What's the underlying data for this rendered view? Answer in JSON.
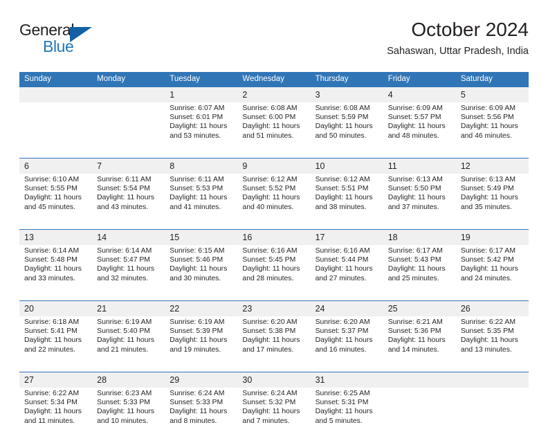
{
  "brand": {
    "line1": "General",
    "line2": "Blue",
    "logo_icon": "blue-triangle-icon",
    "accent_color": "#2177b8",
    "triangle_color": "#1361a4"
  },
  "header": {
    "month_title": "October 2024",
    "location": "Sahaswan, Uttar Pradesh, India"
  },
  "calendar": {
    "header_bg": "#3075b6",
    "daynum_bg": "#f0f0f0",
    "weekday_headers": [
      "Sunday",
      "Monday",
      "Tuesday",
      "Wednesday",
      "Thursday",
      "Friday",
      "Saturday"
    ],
    "weeks": [
      [
        {
          "day": "",
          "info": ""
        },
        {
          "day": "",
          "info": ""
        },
        {
          "day": "1",
          "info": "Sunrise: 6:07 AM\nSunset: 6:01 PM\nDaylight: 11 hours\nand 53 minutes."
        },
        {
          "day": "2",
          "info": "Sunrise: 6:08 AM\nSunset: 6:00 PM\nDaylight: 11 hours\nand 51 minutes."
        },
        {
          "day": "3",
          "info": "Sunrise: 6:08 AM\nSunset: 5:59 PM\nDaylight: 11 hours\nand 50 minutes."
        },
        {
          "day": "4",
          "info": "Sunrise: 6:09 AM\nSunset: 5:57 PM\nDaylight: 11 hours\nand 48 minutes."
        },
        {
          "day": "5",
          "info": "Sunrise: 6:09 AM\nSunset: 5:56 PM\nDaylight: 11 hours\nand 46 minutes."
        }
      ],
      [
        {
          "day": "6",
          "info": "Sunrise: 6:10 AM\nSunset: 5:55 PM\nDaylight: 11 hours\nand 45 minutes."
        },
        {
          "day": "7",
          "info": "Sunrise: 6:11 AM\nSunset: 5:54 PM\nDaylight: 11 hours\nand 43 minutes."
        },
        {
          "day": "8",
          "info": "Sunrise: 6:11 AM\nSunset: 5:53 PM\nDaylight: 11 hours\nand 41 minutes."
        },
        {
          "day": "9",
          "info": "Sunrise: 6:12 AM\nSunset: 5:52 PM\nDaylight: 11 hours\nand 40 minutes."
        },
        {
          "day": "10",
          "info": "Sunrise: 6:12 AM\nSunset: 5:51 PM\nDaylight: 11 hours\nand 38 minutes."
        },
        {
          "day": "11",
          "info": "Sunrise: 6:13 AM\nSunset: 5:50 PM\nDaylight: 11 hours\nand 37 minutes."
        },
        {
          "day": "12",
          "info": "Sunrise: 6:13 AM\nSunset: 5:49 PM\nDaylight: 11 hours\nand 35 minutes."
        }
      ],
      [
        {
          "day": "13",
          "info": "Sunrise: 6:14 AM\nSunset: 5:48 PM\nDaylight: 11 hours\nand 33 minutes."
        },
        {
          "day": "14",
          "info": "Sunrise: 6:14 AM\nSunset: 5:47 PM\nDaylight: 11 hours\nand 32 minutes."
        },
        {
          "day": "15",
          "info": "Sunrise: 6:15 AM\nSunset: 5:46 PM\nDaylight: 11 hours\nand 30 minutes."
        },
        {
          "day": "16",
          "info": "Sunrise: 6:16 AM\nSunset: 5:45 PM\nDaylight: 11 hours\nand 28 minutes."
        },
        {
          "day": "17",
          "info": "Sunrise: 6:16 AM\nSunset: 5:44 PM\nDaylight: 11 hours\nand 27 minutes."
        },
        {
          "day": "18",
          "info": "Sunrise: 6:17 AM\nSunset: 5:43 PM\nDaylight: 11 hours\nand 25 minutes."
        },
        {
          "day": "19",
          "info": "Sunrise: 6:17 AM\nSunset: 5:42 PM\nDaylight: 11 hours\nand 24 minutes."
        }
      ],
      [
        {
          "day": "20",
          "info": "Sunrise: 6:18 AM\nSunset: 5:41 PM\nDaylight: 11 hours\nand 22 minutes."
        },
        {
          "day": "21",
          "info": "Sunrise: 6:19 AM\nSunset: 5:40 PM\nDaylight: 11 hours\nand 21 minutes."
        },
        {
          "day": "22",
          "info": "Sunrise: 6:19 AM\nSunset: 5:39 PM\nDaylight: 11 hours\nand 19 minutes."
        },
        {
          "day": "23",
          "info": "Sunrise: 6:20 AM\nSunset: 5:38 PM\nDaylight: 11 hours\nand 17 minutes."
        },
        {
          "day": "24",
          "info": "Sunrise: 6:20 AM\nSunset: 5:37 PM\nDaylight: 11 hours\nand 16 minutes."
        },
        {
          "day": "25",
          "info": "Sunrise: 6:21 AM\nSunset: 5:36 PM\nDaylight: 11 hours\nand 14 minutes."
        },
        {
          "day": "26",
          "info": "Sunrise: 6:22 AM\nSunset: 5:35 PM\nDaylight: 11 hours\nand 13 minutes."
        }
      ],
      [
        {
          "day": "27",
          "info": "Sunrise: 6:22 AM\nSunset: 5:34 PM\nDaylight: 11 hours\nand 11 minutes."
        },
        {
          "day": "28",
          "info": "Sunrise: 6:23 AM\nSunset: 5:33 PM\nDaylight: 11 hours\nand 10 minutes."
        },
        {
          "day": "29",
          "info": "Sunrise: 6:24 AM\nSunset: 5:33 PM\nDaylight: 11 hours\nand 8 minutes."
        },
        {
          "day": "30",
          "info": "Sunrise: 6:24 AM\nSunset: 5:32 PM\nDaylight: 11 hours\nand 7 minutes."
        },
        {
          "day": "31",
          "info": "Sunrise: 6:25 AM\nSunset: 5:31 PM\nDaylight: 11 hours\nand 5 minutes."
        },
        {
          "day": "",
          "info": ""
        },
        {
          "day": "",
          "info": ""
        }
      ]
    ]
  }
}
